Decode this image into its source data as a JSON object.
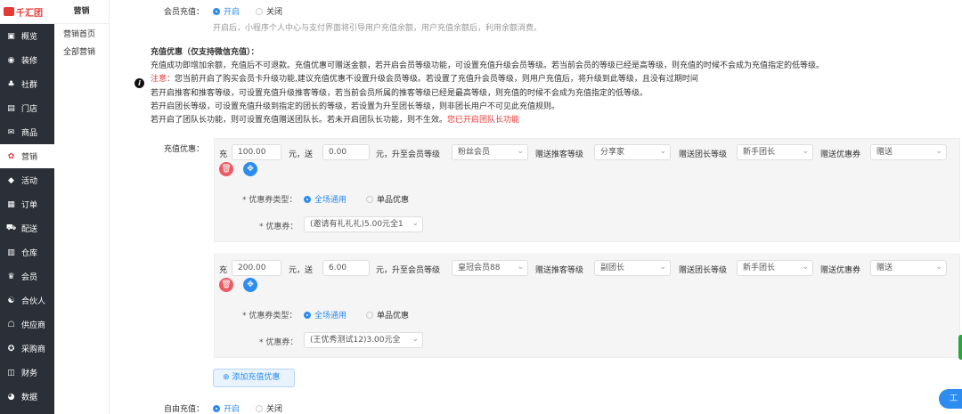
{
  "brand": "千汇团",
  "sidebar": {
    "items": [
      {
        "label": "概览",
        "icon": "overview-icon"
      },
      {
        "label": "装修",
        "icon": "decorate-icon"
      },
      {
        "label": "社群",
        "icon": "community-icon"
      },
      {
        "label": "门店",
        "icon": "store-icon"
      },
      {
        "label": "商品",
        "icon": "goods-icon"
      },
      {
        "label": "营销",
        "icon": "marketing-icon"
      },
      {
        "label": "活动",
        "icon": "activity-icon"
      },
      {
        "label": "订单",
        "icon": "order-icon"
      },
      {
        "label": "配送",
        "icon": "delivery-icon"
      },
      {
        "label": "仓库",
        "icon": "warehouse-icon"
      },
      {
        "label": "会员",
        "icon": "member-icon"
      },
      {
        "label": "合伙人",
        "icon": "partner-icon"
      },
      {
        "label": "供应商",
        "icon": "supplier-icon"
      },
      {
        "label": "采购商",
        "icon": "purchaser-icon"
      },
      {
        "label": "财务",
        "icon": "finance-icon"
      },
      {
        "label": "数据",
        "icon": "data-icon"
      }
    ]
  },
  "subnav": {
    "title": "营销",
    "items": [
      "营销首页",
      "全部营销"
    ]
  },
  "member_recharge": {
    "label": "会员充值：",
    "on": "开启",
    "off": "关闭",
    "hint": "开启后，小程序个人中心与支付界面将引导用户充值余额，用户充值余额后，利用余额消费。"
  },
  "promo_info": {
    "title": "充值优惠（仅支持微信充值）：",
    "line1": "充值成功即增加余额，充值后不可退款。充值优惠可赠送金额，若开启会员等级功能，可设置充值升级会员等级。若当前会员的等级已经是高等级，则充值的时候不会成为充值指定的低等级。",
    "note_label": "注意：",
    "line2": "您当前开启了购买会员卡升级功能,建议充值优惠不设置升级会员等级。若设置了充值升会员等级，则用户充值后，将升级到此等级，且没有过期时间",
    "line3": "若开启推客和推客等级，可设置充值升级推客等级，若当前会员所属的推客等级已经是最高等级，则充值的时候不会成为充值指定的低等级。",
    "line4": "若开启团长等级，可设置充值升级到指定的团长的等级，若设置为升至团长等级，则非团长用户不可见此充值规则。",
    "line5": "若开启了团队长功能，则可设置充值赠送团队长。若未开启团队长功能，则不生效。",
    "line5_red": "您已开启团队长功能"
  },
  "promo": {
    "label": "充值优惠：",
    "text_charge": "充",
    "text_yuan_send": "元，送",
    "text_yuan_upgrade": "元，升至会员等级",
    "text_referrer": "赠送推客等级",
    "text_leader": "赠送团长等级",
    "text_coupon_gift": "赠送优惠券",
    "coupon_type_label": "* 优惠券类型：",
    "coupon_label": "* 优惠券：",
    "all_store": "全场通用",
    "single": "单品优惠",
    "rules": [
      {
        "amount": "100.00",
        "bonus": "0.00",
        "member_level": "粉丝会员",
        "referrer_level": "分享家",
        "leader_level": "新手团长",
        "coupon_gift": "赠送",
        "coupon": "(邀请有礼礼礼)5.00元全1"
      },
      {
        "amount": "200.00",
        "bonus": "6.00",
        "member_level": "皇冠会员88",
        "referrer_level": "副团长",
        "leader_level": "新手团长",
        "coupon_gift": "赠送",
        "coupon": "(王优秀测试12)3.00元全"
      }
    ],
    "add_button": "添加充值优惠"
  },
  "free_recharge": {
    "label": "自由充值：",
    "on": "开启",
    "off": "关闭"
  },
  "float_button": "工"
}
